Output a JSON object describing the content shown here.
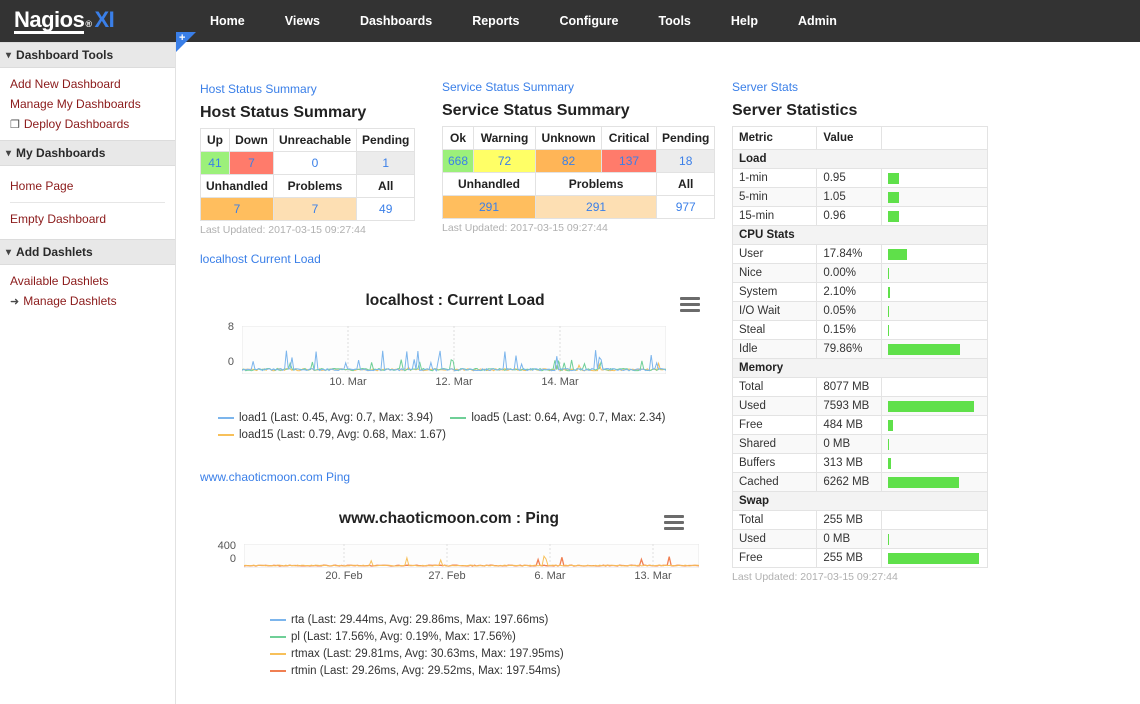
{
  "brand": {
    "name_main": "Nagios",
    "reg": "®",
    "suffix": "XI"
  },
  "topnav": {
    "items": [
      {
        "label": "Home"
      },
      {
        "label": "Views"
      },
      {
        "label": "Dashboards"
      },
      {
        "label": "Reports"
      },
      {
        "label": "Configure"
      },
      {
        "label": "Tools"
      },
      {
        "label": "Help"
      },
      {
        "label": "Admin"
      }
    ]
  },
  "tabnub": {
    "icon": "plus-icon",
    "label": "+"
  },
  "sidebar": {
    "sections": [
      {
        "title": "Dashboard Tools",
        "chevron": "chevron-down-icon",
        "items": [
          {
            "label": "Add New Dashboard",
            "icon": ""
          },
          {
            "label": "Manage My Dashboards",
            "icon": ""
          },
          {
            "label": "Deploy Dashboards",
            "icon": "copy-icon"
          }
        ]
      },
      {
        "title": "My Dashboards",
        "chevron": "chevron-down-icon",
        "items": [
          {
            "label": "Home Page",
            "icon": ""
          },
          {
            "label": "Empty Dashboard",
            "icon": ""
          }
        ]
      },
      {
        "title": "Add Dashlets",
        "chevron": "chevron-down-icon",
        "items": [
          {
            "label": "Available Dashlets",
            "icon": ""
          },
          {
            "label": "Manage Dashlets",
            "icon": "arrow-icon"
          }
        ]
      }
    ]
  },
  "host_status": {
    "link": "Host Status Summary",
    "title": "Host Status Summary",
    "headers_row1": [
      "Up",
      "Down",
      "Unreachable",
      "Pending"
    ],
    "values_row1": [
      "41",
      "7",
      "0",
      "1"
    ],
    "headers_row2": [
      "Unhandled",
      "Problems",
      "All"
    ],
    "values_row2": [
      "7",
      "7",
      "49"
    ],
    "last_updated": "Last Updated: 2017-03-15 09:27:44"
  },
  "service_status": {
    "link": "Service Status Summary",
    "title": "Service Status Summary",
    "headers_row1": [
      "Ok",
      "Warning",
      "Unknown",
      "Critical",
      "Pending"
    ],
    "values_row1": [
      "668",
      "72",
      "82",
      "137",
      "18"
    ],
    "headers_row2": [
      "Unhandled",
      "Problems",
      "All"
    ],
    "values_row2": [
      "291",
      "291",
      "977"
    ],
    "last_updated": "Last Updated: 2017-03-15 09:27:44"
  },
  "server_stats": {
    "link": "Server Stats",
    "title": "Server Statistics",
    "headers": [
      "Metric",
      "Value",
      ""
    ],
    "rows": [
      {
        "group": "Load"
      },
      {
        "metric": "1-min",
        "value": "0.95",
        "pct": 12
      },
      {
        "metric": "5-min",
        "value": "1.05",
        "pct": 12
      },
      {
        "metric": "15-min",
        "value": "0.96",
        "pct": 12
      },
      {
        "group": "CPU Stats"
      },
      {
        "metric": "User",
        "value": "17.84%",
        "pct": 21
      },
      {
        "metric": "Nice",
        "value": "0.00%",
        "pct": 1
      },
      {
        "metric": "System",
        "value": "2.10%",
        "pct": 3
      },
      {
        "metric": "I/O Wait",
        "value": "0.05%",
        "pct": 1
      },
      {
        "metric": "Steal",
        "value": "0.15%",
        "pct": 1
      },
      {
        "metric": "Idle",
        "value": "79.86%",
        "pct": 80
      },
      {
        "group": "Memory"
      },
      {
        "metric": "Total",
        "value": "8077 MB",
        "pct": 0
      },
      {
        "metric": "Used",
        "value": "7593 MB",
        "pct": 94
      },
      {
        "metric": "Free",
        "value": "484 MB",
        "pct": 6
      },
      {
        "metric": "Shared",
        "value": "0 MB",
        "pct": 1
      },
      {
        "metric": "Buffers",
        "value": "313 MB",
        "pct": 4
      },
      {
        "metric": "Cached",
        "value": "6262 MB",
        "pct": 78
      },
      {
        "group": "Swap"
      },
      {
        "metric": "Total",
        "value": "255 MB",
        "pct": 0
      },
      {
        "metric": "Used",
        "value": "0 MB",
        "pct": 1
      },
      {
        "metric": "Free",
        "value": "255 MB",
        "pct": 100
      }
    ],
    "last_updated": "Last Updated: 2017-03-15 09:27:44"
  },
  "chart_data": [
    {
      "type": "line",
      "dashlet_link": "localhost Current Load",
      "title": "localhost : Current Load",
      "menu_icon": "hamburger-icon",
      "xlabel": "",
      "ylabel": "",
      "ylim": [
        0,
        8
      ],
      "yticks": [
        "0",
        "8"
      ],
      "xticks": [
        "10. Mar",
        "12. Mar",
        "14. Mar"
      ],
      "grid": true,
      "legend_position": "bottom",
      "series": [
        {
          "name": "load1",
          "label": "load1 (Last: 0.45, Avg: 0.7, Max: 3.94)",
          "color": "#7cb5ec",
          "last": 0.45,
          "avg": 0.7,
          "max": 3.94
        },
        {
          "name": "load5",
          "label": "load5 (Last: 0.64, Avg: 0.7, Max: 2.34)",
          "color": "#6fcf97",
          "last": 0.64,
          "avg": 0.7,
          "max": 2.34
        },
        {
          "name": "load15",
          "label": "load15 (Last: 0.79, Avg: 0.68, Max: 1.67)",
          "color": "#f7c05a",
          "last": 0.79,
          "avg": 0.68,
          "max": 1.67
        }
      ]
    },
    {
      "type": "line",
      "dashlet_link": "www.chaoticmoon.com Ping",
      "title": "www.chaoticmoon.com : Ping",
      "menu_icon": "hamburger-icon",
      "xlabel": "",
      "ylabel": "",
      "ylim": [
        0,
        400
      ],
      "yticks": [
        "0",
        "400"
      ],
      "xticks": [
        "20. Feb",
        "27. Feb",
        "6. Mar",
        "13. Mar"
      ],
      "grid": true,
      "legend_position": "bottom",
      "series": [
        {
          "name": "rta",
          "label": "rta (Last: 29.44ms, Avg: 29.86ms, Max: 197.66ms)",
          "color": "#7cb5ec",
          "last": 29.44,
          "avg": 29.86,
          "max": 197.66
        },
        {
          "name": "pl",
          "label": "pl (Last: 17.56%, Avg: 0.19%, Max: 17.56%)",
          "color": "#6fcf97",
          "last": 17.56,
          "avg": 0.19,
          "max": 17.56
        },
        {
          "name": "rtmax",
          "label": "rtmax (Last: 29.81ms, Avg: 30.63ms, Max: 197.95ms)",
          "color": "#f7c05a",
          "last": 29.81,
          "avg": 30.63,
          "max": 197.95
        },
        {
          "name": "rtmin",
          "label": "rtmin (Last: 29.26ms, Avg: 29.52ms, Max: 197.54ms)",
          "color": "#f07f52",
          "last": 29.26,
          "avg": 29.52,
          "max": 197.54
        }
      ]
    }
  ]
}
